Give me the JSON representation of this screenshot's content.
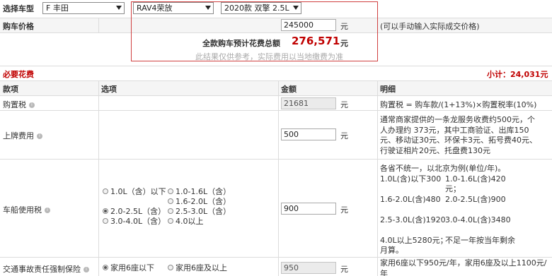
{
  "selector": {
    "label": "选择车型",
    "brand": "F 丰田",
    "series": "RAV4荣放",
    "model": "2020款 双擎 2.5L"
  },
  "price_row": {
    "label": "购车价格",
    "value": "245000",
    "unit": "元",
    "note": "(可以手动输入实际成交价格)"
  },
  "summary": {
    "total_label": "全款购车预计花费总额",
    "total_value": "276,571",
    "total_unit": "元",
    "disclaimer": "此结果仅供参考，实际费用以当地缴费为准"
  },
  "section": {
    "title": "必要花费",
    "subtotal_label": "小计：",
    "subtotal_value": "24,031元"
  },
  "table_header": {
    "item": "款项",
    "option": "选项",
    "amount": "金额",
    "detail": "明细"
  },
  "rows": {
    "purchase_tax": {
      "label": "购置税",
      "amount": "21681",
      "unit": "元",
      "detail": "购置税 = 购车款/(1+13%)×购置税率(10%)"
    },
    "plate_fee": {
      "label": "上牌费用",
      "amount": "500",
      "unit": "元",
      "detail": [
        "通常商家提供的一条龙服务收费约500元，个",
        "人办理约 373元，其中工商验证、出库150",
        "元、移动证30元、环保卡3元、拓号费40元、",
        "行驶证相片20元、托盘费130元"
      ]
    },
    "vehicle_tax": {
      "label": "车船使用税",
      "amount": "900",
      "unit": "元",
      "options": [
        "1.0L（含）以下",
        "1.0-1.6L（含）",
        "1.6-2.0L（含）",
        "2.0-2.5L（含）",
        "2.5-3.0L（含）",
        "3.0-4.0L（含）",
        "4.0以上"
      ],
      "detail": [
        "各省不统一，以北京为例(单位/年)。",
        "1.0L(含)以下300",
        "元；",
        "1.0-1.6L(含)420",
        "元；",
        "1.6-2.0L(含)480",
        "元；",
        "2.0-2.5L(含)900",
        "元；",
        "2.5-3.0L(含)1920",
        "元；",
        "3.0-4.0L(含)3480",
        "元；",
        "4.0L以上5280元；",
        "不足一年按当年剩余",
        "月算。"
      ]
    },
    "insurance": {
      "label": "交通事故责任强制保险",
      "amount": "950",
      "unit": "元",
      "options": [
        "家用6座以下",
        "家用6座及以上"
      ],
      "detail": "家用6座以下950元/年，家用6座及以上1100元/年"
    }
  },
  "colors": {
    "accent_red": "#c00000",
    "highlight_border": "#d04040",
    "grid": "#dcdcdc"
  }
}
